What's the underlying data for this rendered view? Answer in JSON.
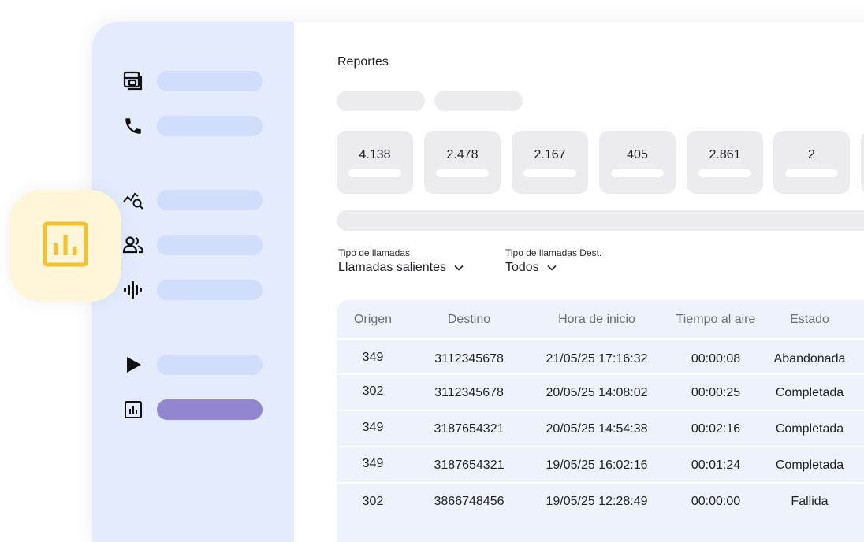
{
  "page": {
    "title": "Reportes"
  },
  "stats": [
    {
      "value": "4.138"
    },
    {
      "value": "2.478"
    },
    {
      "value": "2.167"
    },
    {
      "value": "405"
    },
    {
      "value": "2.861"
    },
    {
      "value": "2"
    }
  ],
  "filters": {
    "call_type": {
      "label": "Tipo de llamadas",
      "value": "Llamadas salientes"
    },
    "dest_type": {
      "label": "Tipo de llamadas Dest.",
      "value": "Todos"
    }
  },
  "table": {
    "columns": [
      "Origen",
      "Destino",
      "Hora de inicio",
      "Tiempo al aire",
      "Estado"
    ],
    "rows": [
      [
        "349",
        "3112345678",
        "21/05/25 17:16:32",
        "00:00:08",
        "Abandonada"
      ],
      [
        "302",
        "3112345678",
        "20/05/25 14:08:02",
        "00:00:25",
        "Completada"
      ],
      [
        "349",
        "3187654321",
        "20/05/25 14:54:38",
        "00:02:16",
        "Completada"
      ],
      [
        "349",
        "3187654321",
        "19/05/25 16:02:16",
        "00:01:24",
        "Completada"
      ],
      [
        "302",
        "3866748456",
        "19/05/25 12:28:49",
        "00:00:00",
        "Fallida"
      ]
    ]
  },
  "sidebar": {
    "items": [
      {
        "icon": "dashboard-icon"
      },
      {
        "icon": "phone-icon"
      },
      {
        "icon": "analytics-search-icon"
      },
      {
        "icon": "users-icon"
      },
      {
        "icon": "audio-wave-icon"
      },
      {
        "icon": "play-icon"
      },
      {
        "icon": "report-chart-icon",
        "active": true
      }
    ]
  },
  "colors": {
    "sidebar_bg": "#e3ebfd",
    "sidebar_pill": "#d0ddfb",
    "active_pill": "#9386d1",
    "badge_bg": "#fff5d8",
    "badge_icon": "#f2c12e",
    "table_bg": "#eef2fd"
  }
}
